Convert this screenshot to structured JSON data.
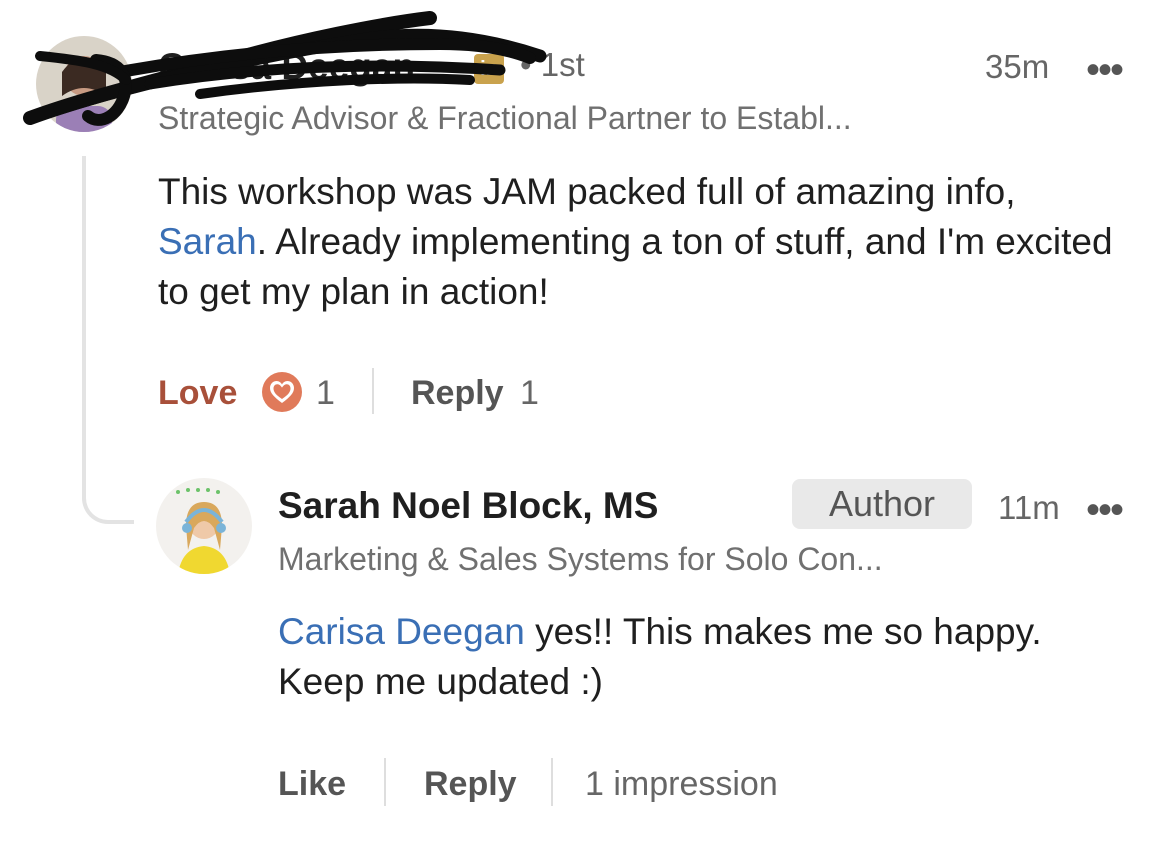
{
  "comment": {
    "author_name": "Carisa Deegan",
    "linkedin_badge": "in",
    "degree": "• 1st",
    "headline": "Strategic Advisor & Fractional Partner to Establ...",
    "time": "35m",
    "more": "•••",
    "body": {
      "part1": "This workshop was JAM packed full of amazing info, ",
      "mention": "Sarah",
      "part2": ". Already implementing a ton of stuff, and I'm excited to get my plan in action!"
    },
    "actions": {
      "love_label": "Love",
      "reaction_count": "1",
      "reply_label": "Reply",
      "reply_count": "1"
    }
  },
  "reply": {
    "author_name": "Sarah Noel Block, MS",
    "badge": "Author",
    "time": "11m",
    "more": "•••",
    "headline": "Marketing & Sales Systems for Solo Con...",
    "body": {
      "mention": "Carisa Deegan",
      "text": " yes!! This makes me so happy. Keep me updated :)"
    },
    "actions": {
      "like_label": "Like",
      "reply_label": "Reply",
      "impressions": "1 impression"
    }
  },
  "colors": {
    "mention": "#3a6fb5",
    "love": "#a8503a",
    "love_icon_fill": "#e07a5a"
  },
  "icons": [
    "love-reaction-icon",
    "more-options-icon",
    "linkedin-badge-icon"
  ]
}
